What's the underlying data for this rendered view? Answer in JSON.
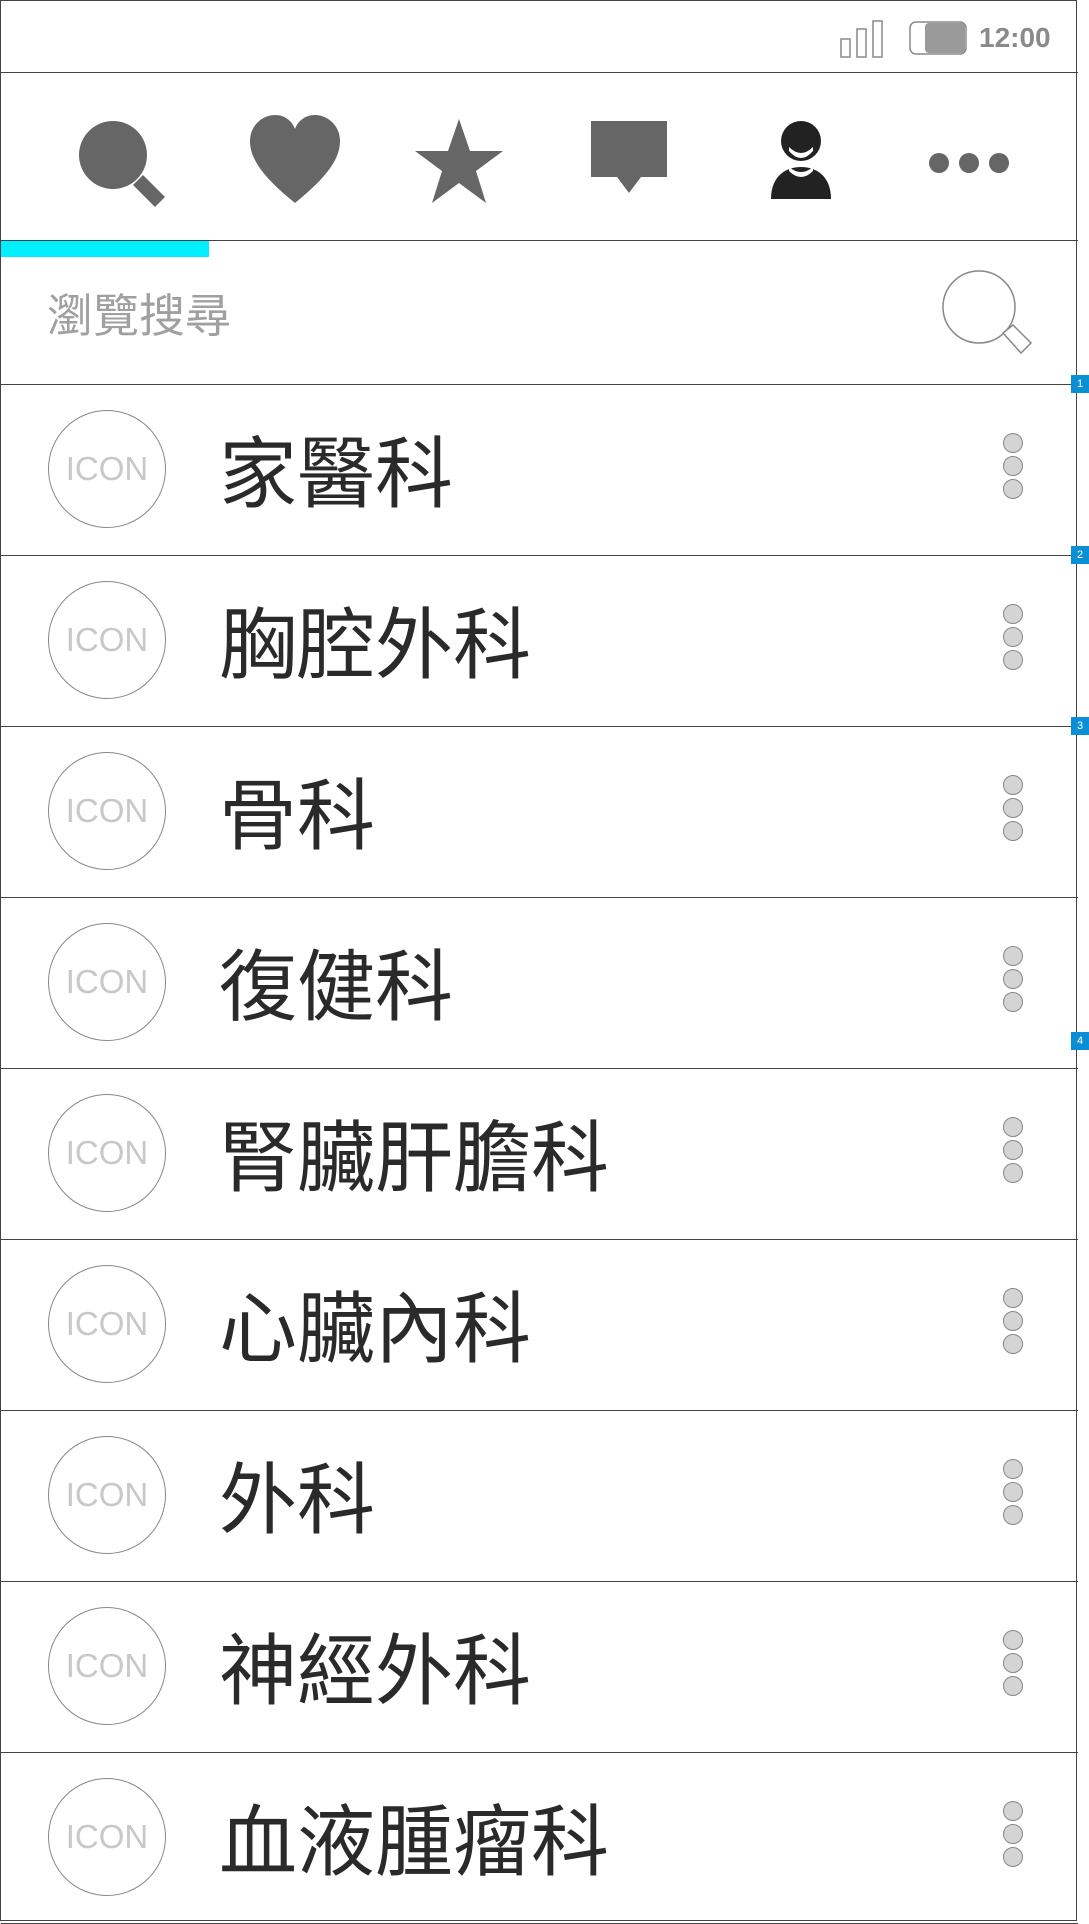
{
  "status_bar": {
    "time": "12:00",
    "signal_icon": "signal-bars-icon",
    "battery_icon": "battery-icon"
  },
  "toolbar": {
    "items": [
      {
        "name": "search",
        "icon": "search-icon"
      },
      {
        "name": "favorites",
        "icon": "heart-icon"
      },
      {
        "name": "starred",
        "icon": "star-icon"
      },
      {
        "name": "messages",
        "icon": "chat-bubble-icon"
      },
      {
        "name": "profile",
        "icon": "user-icon"
      },
      {
        "name": "more",
        "icon": "more-dots-icon"
      }
    ],
    "active_index": 0,
    "accent_color": "#00f0ff",
    "icon_color": "#666666"
  },
  "search": {
    "placeholder": "瀏覽搜尋",
    "button_icon": "magnifier-icon"
  },
  "markers": [
    "1",
    "2",
    "3",
    "4"
  ],
  "departments": {
    "avatar_text": "ICON",
    "items": [
      {
        "label": "家醫科"
      },
      {
        "label": "胸腔外科"
      },
      {
        "label": "骨科"
      },
      {
        "label": "復健科"
      },
      {
        "label": "腎臟肝膽科"
      },
      {
        "label": "心臟內科"
      },
      {
        "label": "外科"
      },
      {
        "label": "神經外科"
      },
      {
        "label": "血液腫瘤科"
      }
    ]
  }
}
